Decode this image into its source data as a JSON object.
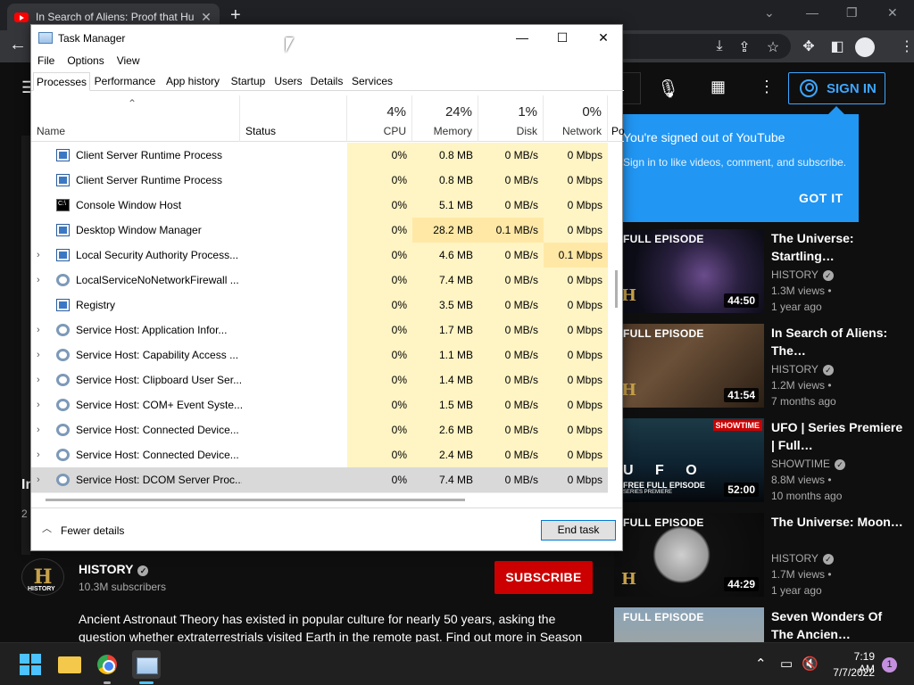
{
  "browser": {
    "tab_title": "In Search of Aliens: Proof that Hu",
    "tab_close": "✕",
    "new_tab": "+"
  },
  "youtube": {
    "signin_label": "SIGN IN",
    "popover": {
      "title": "You're signed out of YouTube",
      "text": "Sign in to like videos, comment, and subscribe.",
      "button": "GOT IT"
    },
    "title_fragment": "In",
    "date_fragment": "2",
    "videos": [
      {
        "thumb_label": "FULL EPISODE",
        "title": "The Universe: Startling…",
        "channel": "HISTORY",
        "views": "1.3M views •",
        "age": "1 year ago",
        "duration": "44:50"
      },
      {
        "thumb_label": "FULL EPISODE",
        "title": "In Search of Aliens: The…",
        "channel": "HISTORY",
        "views": "1.2M views •",
        "age": "7 months ago",
        "duration": "41:54"
      },
      {
        "thumb_label": "U F O",
        "thumb_sub": "FREE FULL EPISODE",
        "thumb_sub2": "SERIES PREMIERE",
        "title": "UFO | Series Premiere | Full…",
        "channel": "SHOWTIME",
        "views": "8.8M views •",
        "age": "10 months ago",
        "duration": "52:00",
        "badge": "SHOWTIME"
      },
      {
        "thumb_label": "FULL EPISODE",
        "title": "The Universe: Moon…",
        "channel": "HISTORY",
        "views": "1.7M views •",
        "age": "1 year ago",
        "duration": "44:29"
      },
      {
        "thumb_label": "FULL EPISODE",
        "title": "Seven Wonders Of The Ancien…",
        "channel": "",
        "views": "",
        "age": "",
        "duration": ""
      }
    ],
    "channel": {
      "avatar_text": "H",
      "avatar_caption": "HISTORY",
      "name": "HISTORY",
      "subscribers": "10.3M subscribers",
      "subscribe_label": "SUBSCRIBE"
    },
    "description": "Ancient Astronaut Theory has existed in popular culture for nearly 50 years, asking the question whether extraterrestrials visited Earth in the remote past. Find out more in Season"
  },
  "taskmgr": {
    "title": "Task Manager",
    "menu": [
      "File",
      "Options",
      "View"
    ],
    "tabs": [
      "Processes",
      "Performance",
      "App history",
      "Startup",
      "Users",
      "Details",
      "Services"
    ],
    "columns": {
      "name": "Name",
      "status": "Status",
      "cpu_pct": "4%",
      "cpu": "CPU",
      "mem_pct": "24%",
      "mem": "Memory",
      "disk_pct": "1%",
      "disk": "Disk",
      "net_pct": "0%",
      "net": "Network",
      "power": "Po"
    },
    "processes": [
      {
        "name": "Client Server Runtime Process",
        "icon": "window-icon",
        "expandable": false,
        "cpu": "0%",
        "mem": "0.8 MB",
        "disk": "0 MB/s",
        "net": "0 Mbps"
      },
      {
        "name": "Client Server Runtime Process",
        "icon": "window-icon",
        "expandable": false,
        "cpu": "0%",
        "mem": "0.8 MB",
        "disk": "0 MB/s",
        "net": "0 Mbps"
      },
      {
        "name": "Console Window Host",
        "icon": "console-icon",
        "expandable": false,
        "cpu": "0%",
        "mem": "5.1 MB",
        "disk": "0 MB/s",
        "net": "0 Mbps"
      },
      {
        "name": "Desktop Window Manager",
        "icon": "window-icon",
        "expandable": false,
        "cpu": "0%",
        "mem": "28.2 MB",
        "disk": "0.1 MB/s",
        "net": "0 Mbps"
      },
      {
        "name": "Local Security Authority Process...",
        "icon": "window-icon",
        "expandable": true,
        "cpu": "0%",
        "mem": "4.6 MB",
        "disk": "0 MB/s",
        "net": "0.1 Mbps"
      },
      {
        "name": "LocalServiceNoNetworkFirewall ...",
        "icon": "gear-icon",
        "expandable": true,
        "cpu": "0%",
        "mem": "7.4 MB",
        "disk": "0 MB/s",
        "net": "0 Mbps"
      },
      {
        "name": "Registry",
        "icon": "window-icon",
        "expandable": false,
        "cpu": "0%",
        "mem": "3.5 MB",
        "disk": "0 MB/s",
        "net": "0 Mbps"
      },
      {
        "name": "Service Host: Application Infor...",
        "icon": "gear-icon",
        "expandable": true,
        "cpu": "0%",
        "mem": "1.7 MB",
        "disk": "0 MB/s",
        "net": "0 Mbps"
      },
      {
        "name": "Service Host: Capability Access ...",
        "icon": "gear-icon",
        "expandable": true,
        "cpu": "0%",
        "mem": "1.1 MB",
        "disk": "0 MB/s",
        "net": "0 Mbps"
      },
      {
        "name": "Service Host: Clipboard User Ser...",
        "icon": "gear-icon",
        "expandable": true,
        "cpu": "0%",
        "mem": "1.4 MB",
        "disk": "0 MB/s",
        "net": "0 Mbps"
      },
      {
        "name": "Service Host: COM+ Event Syste...",
        "icon": "gear-icon",
        "expandable": true,
        "cpu": "0%",
        "mem": "1.5 MB",
        "disk": "0 MB/s",
        "net": "0 Mbps"
      },
      {
        "name": "Service Host: Connected Device...",
        "icon": "gear-icon",
        "expandable": true,
        "cpu": "0%",
        "mem": "2.6 MB",
        "disk": "0 MB/s",
        "net": "0 Mbps"
      },
      {
        "name": "Service Host: Connected Device...",
        "icon": "gear-icon",
        "expandable": true,
        "cpu": "0%",
        "mem": "2.4 MB",
        "disk": "0 MB/s",
        "net": "0 Mbps"
      },
      {
        "name": "Service Host: DCOM Server Proc...",
        "icon": "gear-icon",
        "expandable": true,
        "selected": true,
        "cpu": "0%",
        "mem": "7.4 MB",
        "disk": "0 MB/s",
        "net": "0 Mbps"
      }
    ],
    "fewer_details": "Fewer details",
    "end_task": "End task"
  },
  "taskbar": {
    "time": "7:19 AM",
    "date": "7/7/2022",
    "notifications": "1"
  },
  "colors": {
    "yt_red": "#cc0000",
    "popover_blue": "#2196f3",
    "cpu_column_tint": "#fff4c4",
    "selection_gray": "#d9d9d9"
  }
}
